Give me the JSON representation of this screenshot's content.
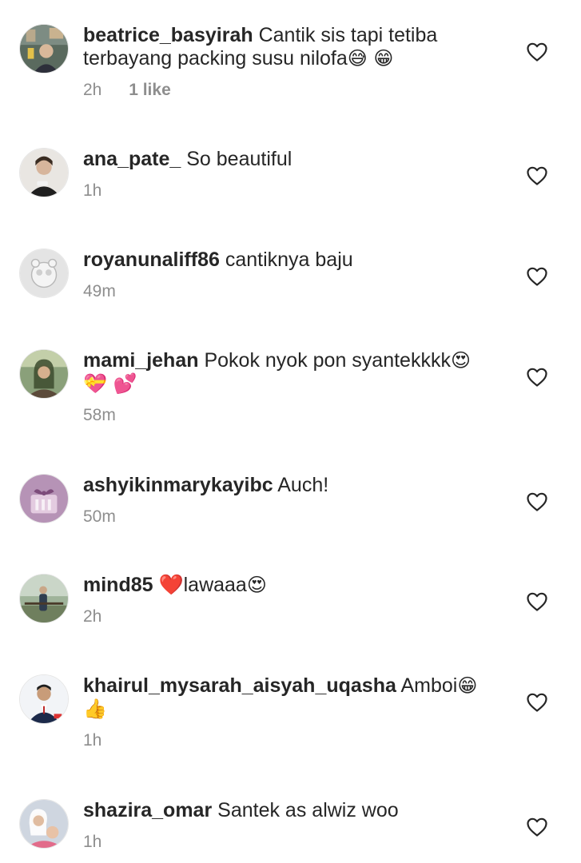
{
  "comments": [
    {
      "username": "beatrice_basyirah",
      "text": "Cantik sis tapi tetiba terbayang packing susu nilofa",
      "emojis": "😅 😁",
      "time": "2h",
      "likes": "1 like",
      "avatar_icon": "user-avatar-photo"
    },
    {
      "username": "ana_pate_",
      "text": "So beautiful",
      "emojis": "",
      "time": "1h",
      "likes": "",
      "avatar_icon": "user-avatar-photo"
    },
    {
      "username": "royanunaliff86",
      "text": "cantiknya baju",
      "emojis": "",
      "time": "49m",
      "likes": "",
      "avatar_icon": "user-avatar-photo"
    },
    {
      "username": "mami_jehan",
      "text": "Pokok nyok pon syantekkkk",
      "emojis": "😍 💝 💕",
      "time": "58m",
      "likes": "",
      "avatar_icon": "user-avatar-photo"
    },
    {
      "username": "ashyikinmarykayibc",
      "text": "Auch!",
      "emojis": "",
      "time": "50m",
      "likes": "",
      "avatar_icon": "user-avatar-photo"
    },
    {
      "username": "mind85",
      "text": "❤️lawaaa",
      "emojis": "😍",
      "time": "2h",
      "likes": "",
      "avatar_icon": "user-avatar-photo"
    },
    {
      "username": "khairul_mysarah_aisyah_uqasha",
      "text": "Amboi",
      "emojis": "😁 👍",
      "time": "1h",
      "likes": "",
      "avatar_icon": "user-avatar-photo"
    },
    {
      "username": "shazira_omar",
      "text": "Santek as alwiz woo",
      "emojis": "",
      "time": "1h",
      "likes": "",
      "avatar_icon": "user-avatar-photo"
    }
  ],
  "icons": {
    "like": "heart-outline-icon"
  },
  "colors": {
    "text": "#262626",
    "meta": "#8e8e8e",
    "background": "#ffffff"
  }
}
